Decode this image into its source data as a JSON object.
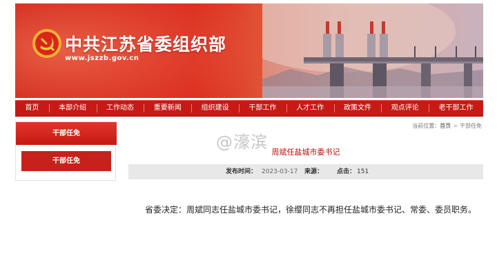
{
  "site": {
    "title": "中共江苏省委组织部",
    "url": "www.jszzb.gov.cn"
  },
  "nav": {
    "items": [
      {
        "label": "首页"
      },
      {
        "label": "本部介绍"
      },
      {
        "label": "工作动态"
      },
      {
        "label": "重要新闻"
      },
      {
        "label": "组织建设"
      },
      {
        "label": "干部工作"
      },
      {
        "label": "人才工作"
      },
      {
        "label": "政策文件"
      },
      {
        "label": "观点评论"
      },
      {
        "label": "老干部工作"
      }
    ]
  },
  "sidebar": {
    "header": "干部任免",
    "active_item": "干部任免"
  },
  "breadcrumb": {
    "prefix": "当前位置：",
    "home": "首页",
    "separator": ">",
    "current": "干部任免"
  },
  "watermark": "@濠滨",
  "article": {
    "title": "周斌任盐城市委书记",
    "date_label": "发布时间：",
    "date": "2023-03-17",
    "source_label": "来源：",
    "views_label": "点击：",
    "views": "151",
    "body": "省委决定：周斌同志任盐城市委书记，徐缨同志不再担任盐城市委书记、常委、委员职务。"
  },
  "colors": {
    "brand_red": "#c71a14",
    "title_red": "#b80c0c",
    "meta_bg": "#e8e8e8"
  },
  "icons": {
    "emblem": "party-emblem-icon"
  }
}
